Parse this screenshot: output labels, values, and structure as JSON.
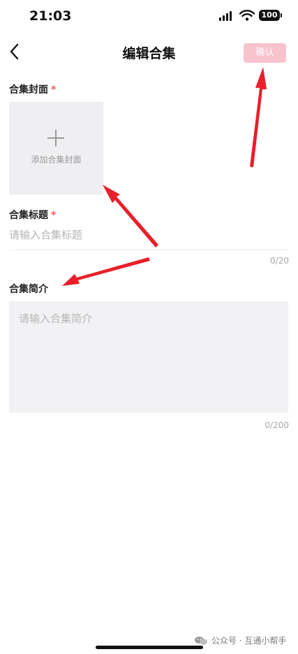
{
  "status_bar": {
    "time": "21:03",
    "battery": "100"
  },
  "header": {
    "title": "编辑合集",
    "confirm_label": "确认"
  },
  "cover": {
    "label": "合集封面",
    "required_mark": "*",
    "add_text": "添加合集封面"
  },
  "title_field": {
    "label": "合集标题",
    "required_mark": "*",
    "placeholder": "请输入合集标题",
    "counter": "0/20"
  },
  "intro_field": {
    "label": "合集简介",
    "placeholder": "请输入合集简介",
    "counter": "0/200"
  },
  "watermark": {
    "text": "公众号 · 互通小帮手"
  },
  "colors": {
    "accent_pink": "#f8c3cd",
    "required_red": "#f25c5c",
    "annotation_red": "#e8202a"
  }
}
